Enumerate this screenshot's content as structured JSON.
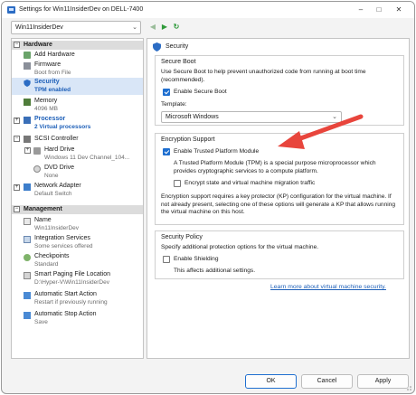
{
  "window": {
    "title": "Settings for Win11InsiderDev on DELL-7400",
    "minimize": "–",
    "maximize": "□",
    "close": "✕"
  },
  "toolbar": {
    "vm_name": "Win11InsiderDev",
    "chevron": "⌄",
    "back": "◀",
    "forward": "▶",
    "refresh": "↻"
  },
  "sidebar": {
    "hardware_label": "Hardware",
    "management_label": "Management",
    "collapse_glyph": "−",
    "expand_glyph": "+",
    "hardware": [
      {
        "name": "Add Hardware",
        "sub": ""
      },
      {
        "name": "Firmware",
        "sub": "Boot from File"
      },
      {
        "name": "Security",
        "sub": "TPM enabled"
      },
      {
        "name": "Memory",
        "sub": "4096 MB"
      },
      {
        "name": "Processor",
        "sub": "2 Virtual processors"
      },
      {
        "name": "SCSI Controller",
        "sub": ""
      },
      {
        "name": "Hard Drive",
        "sub": "Windows 11 Dev Channel_104..."
      },
      {
        "name": "DVD Drive",
        "sub": "None"
      },
      {
        "name": "Network Adapter",
        "sub": "Default Switch"
      }
    ],
    "management": [
      {
        "name": "Name",
        "sub": "Win11InsiderDev"
      },
      {
        "name": "Integration Services",
        "sub": "Some services offered"
      },
      {
        "name": "Checkpoints",
        "sub": "Standard"
      },
      {
        "name": "Smart Paging File Location",
        "sub": "D:\\Hyper-V\\Win11InsiderDev"
      },
      {
        "name": "Automatic Start Action",
        "sub": "Restart if previously running"
      },
      {
        "name": "Automatic Stop Action",
        "sub": "Save"
      }
    ]
  },
  "security": {
    "heading": "Security",
    "secure_boot": {
      "title": "Secure Boot",
      "description": "Use Secure Boot to help prevent unauthorized code from running at boot time (recommended).",
      "checkbox_label": "Enable Secure Boot",
      "checked": true,
      "template_label": "Template:",
      "template_value": "Microsoft Windows"
    },
    "encryption": {
      "title": "Encryption Support",
      "tpm_label": "Enable Trusted Platform Module",
      "tpm_checked": true,
      "tpm_description": "A Trusted Platform Module (TPM) is a special purpose microprocessor which provides cryptographic services to a compute platform.",
      "encrypt_label": "Encrypt state and virtual machine migration traffic",
      "encrypt_checked": false,
      "note": "Encryption support requires a key protector (KP) configuration for the virtual machine. If not already present, selecting one of these options will generate a KP that allows running the virtual machine on this host."
    },
    "policy": {
      "title": "Security Policy",
      "description": "Specify additional protection options for the virtual machine.",
      "shielding_label": "Enable Shielding",
      "shielding_checked": false,
      "shielding_note": "This affects additional settings."
    },
    "learn_more": "Learn more about virtual machine security."
  },
  "buttons": {
    "ok": "OK",
    "cancel": "Cancel",
    "apply": "Apply"
  },
  "colors": {
    "accent": "#1f6fd0",
    "arrow": "#e8453c",
    "selected_bg": "#d9e6f7"
  }
}
